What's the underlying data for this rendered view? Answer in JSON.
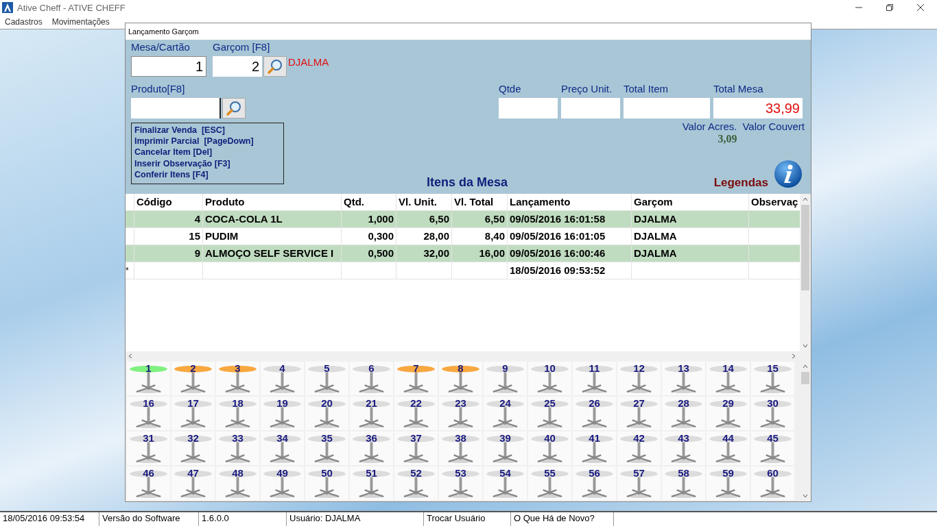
{
  "window": {
    "title": "Ative Cheff - ATIVE CHEFF"
  },
  "menu": [
    "Cadastros",
    "Movimentações"
  ],
  "dialog": {
    "title": "Lançamento Garçom",
    "mesa": {
      "label": "Mesa/Cartão",
      "value": "1"
    },
    "garcom": {
      "label": "Garçom [F8]",
      "value": "2",
      "name": "DJALMA"
    },
    "produto": {
      "label": "Produto[F8]"
    },
    "shortcuts": [
      "Finalizar Venda  [ESC]",
      "Imprimir Parcial  [PageDown]",
      "Cancelar Item [Del]",
      "Inserir Observação [F3]",
      "Conferir Itens [F4]"
    ],
    "fields": [
      {
        "label": "Qtde"
      },
      {
        "label": "Preço Unit."
      },
      {
        "label": "Total Item"
      },
      {
        "label": "Total Mesa",
        "value": "33,99"
      }
    ],
    "extras": [
      {
        "label": "Valor Acres.",
        "value": "3,09"
      },
      {
        "label": "Valor Couvert"
      }
    ],
    "items_title": "Itens da Mesa",
    "legend_label": "Legendas",
    "table": {
      "columns": [
        {
          "label": "Código",
          "kind": "number"
        },
        {
          "label": "Produto",
          "kind": "text"
        },
        {
          "label": "Qtd.",
          "kind": "number"
        },
        {
          "label": "Vl. Unit.",
          "kind": "number"
        },
        {
          "label": "Vl. Total",
          "kind": "number"
        },
        {
          "label": "Lançamento",
          "kind": "text"
        },
        {
          "label": "Garçom",
          "kind": "text"
        },
        {
          "label": "Observaç",
          "kind": "text"
        }
      ],
      "rows": [
        {
          "cells": [
            "4",
            "COCA-COLA 1L",
            "1,000",
            "6,50",
            "6,50",
            "09/05/2016 16:01:58",
            "DJALMA"
          ]
        },
        {
          "cells": [
            "15",
            "PUDIM",
            "0,300",
            "28,00",
            "8,40",
            "09/05/2016 16:01:05",
            "DJALMA"
          ]
        },
        {
          "cells": [
            "9",
            "ALMOÇO SELF SERVICE I",
            "0,500",
            "32,00",
            "16,00",
            "09/05/2016 16:00:46",
            "DJALMA"
          ]
        }
      ],
      "new_row": {
        "marker": "*",
        "lancamento": "18/05/2016 09:53:52"
      }
    },
    "tables": [
      {
        "number": "1",
        "color": "#80f080"
      },
      {
        "number": "2",
        "color": "#f8a840"
      },
      {
        "number": "3",
        "color": "#f8a840"
      },
      {
        "number": "4",
        "color": "#dcdcdc"
      },
      {
        "number": "5",
        "color": "#dcdcdc"
      },
      {
        "number": "6",
        "color": "#dcdcdc"
      },
      {
        "number": "7",
        "color": "#f8a840"
      },
      {
        "number": "8",
        "color": "#f8a840"
      },
      {
        "number": "9",
        "color": "#dcdcdc"
      },
      {
        "number": "10",
        "color": "#dcdcdc"
      },
      {
        "number": "11",
        "color": "#dcdcdc"
      },
      {
        "number": "12",
        "color": "#dcdcdc"
      },
      {
        "number": "13",
        "color": "#dcdcdc"
      },
      {
        "number": "14",
        "color": "#dcdcdc"
      },
      {
        "number": "15",
        "color": "#dcdcdc"
      },
      {
        "number": "16",
        "color": "#dcdcdc"
      },
      {
        "number": "17",
        "color": "#dcdcdc"
      },
      {
        "number": "18",
        "color": "#dcdcdc"
      },
      {
        "number": "19",
        "color": "#dcdcdc"
      },
      {
        "number": "20",
        "color": "#dcdcdc"
      },
      {
        "number": "21",
        "color": "#dcdcdc"
      },
      {
        "number": "22",
        "color": "#dcdcdc"
      },
      {
        "number": "23",
        "color": "#dcdcdc"
      },
      {
        "number": "24",
        "color": "#dcdcdc"
      },
      {
        "number": "25",
        "color": "#dcdcdc"
      },
      {
        "number": "26",
        "color": "#dcdcdc"
      },
      {
        "number": "27",
        "color": "#dcdcdc"
      },
      {
        "number": "28",
        "color": "#dcdcdc"
      },
      {
        "number": "29",
        "color": "#dcdcdc"
      },
      {
        "number": "30",
        "color": "#dcdcdc"
      },
      {
        "number": "31",
        "color": "#dcdcdc"
      },
      {
        "number": "32",
        "color": "#dcdcdc"
      },
      {
        "number": "33",
        "color": "#dcdcdc"
      },
      {
        "number": "34",
        "color": "#dcdcdc"
      },
      {
        "number": "35",
        "color": "#dcdcdc"
      },
      {
        "number": "36",
        "color": "#dcdcdc"
      },
      {
        "number": "37",
        "color": "#dcdcdc"
      },
      {
        "number": "38",
        "color": "#dcdcdc"
      },
      {
        "number": "39",
        "color": "#dcdcdc"
      },
      {
        "number": "40",
        "color": "#dcdcdc"
      },
      {
        "number": "41",
        "color": "#dcdcdc"
      },
      {
        "number": "42",
        "color": "#dcdcdc"
      },
      {
        "number": "43",
        "color": "#dcdcdc"
      },
      {
        "number": "44",
        "color": "#dcdcdc"
      },
      {
        "number": "45",
        "color": "#dcdcdc"
      },
      {
        "number": "46",
        "color": "#dcdcdc"
      },
      {
        "number": "47",
        "color": "#dcdcdc"
      },
      {
        "number": "48",
        "color": "#dcdcdc"
      },
      {
        "number": "49",
        "color": "#dcdcdc"
      },
      {
        "number": "50",
        "color": "#dcdcdc"
      },
      {
        "number": "51",
        "color": "#dcdcdc"
      },
      {
        "number": "52",
        "color": "#dcdcdc"
      },
      {
        "number": "53",
        "color": "#dcdcdc"
      },
      {
        "number": "54",
        "color": "#dcdcdc"
      },
      {
        "number": "55",
        "color": "#dcdcdc"
      },
      {
        "number": "56",
        "color": "#dcdcdc"
      },
      {
        "number": "57",
        "color": "#dcdcdc"
      },
      {
        "number": "58",
        "color": "#dcdcdc"
      },
      {
        "number": "59",
        "color": "#dcdcdc"
      },
      {
        "number": "60",
        "color": "#dcdcdc"
      }
    ]
  },
  "status_bar": [
    "18/05/2016 09:53:54",
    "Versão do Software",
    "1.6.0.0",
    "Usuário: DJALMA",
    "Trocar Usuário",
    "O Que Há de Novo?"
  ]
}
